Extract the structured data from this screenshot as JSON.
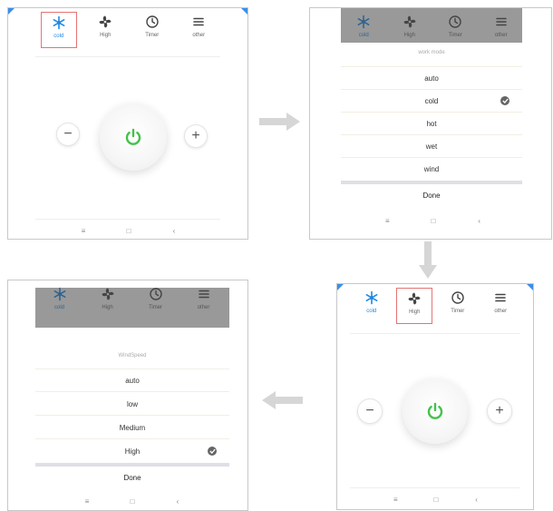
{
  "tabs": [
    {
      "key": "mode",
      "label": "cold",
      "icon": "snowflake-icon"
    },
    {
      "key": "fan",
      "label": "High",
      "icon": "fan-icon"
    },
    {
      "key": "timer",
      "label": "Timer",
      "icon": "clock-icon"
    },
    {
      "key": "other",
      "label": "other",
      "icon": "menu-icon"
    }
  ],
  "work_mode_sheet": {
    "title": "work mode",
    "options": [
      "auto",
      "cold",
      "hot",
      "wet",
      "wind"
    ],
    "selected": "cold",
    "done_label": "Done"
  },
  "wind_speed_sheet": {
    "title": "WindSpeed",
    "options": [
      "auto",
      "low",
      "Medium",
      "High"
    ],
    "selected": "High",
    "done_label": "Done"
  },
  "controls": {
    "minus_glyph": "−",
    "plus_glyph": "+"
  },
  "nav": {
    "menu_glyph": "≡",
    "home_glyph": "□",
    "back_glyph": "‹"
  },
  "colors": {
    "accent_blue": "#1e88e5",
    "power_green": "#43c24b",
    "highlight_red": "#e57373",
    "corner_blue": "#3a8fe8",
    "arrow_gray": "#d6d6d6"
  }
}
